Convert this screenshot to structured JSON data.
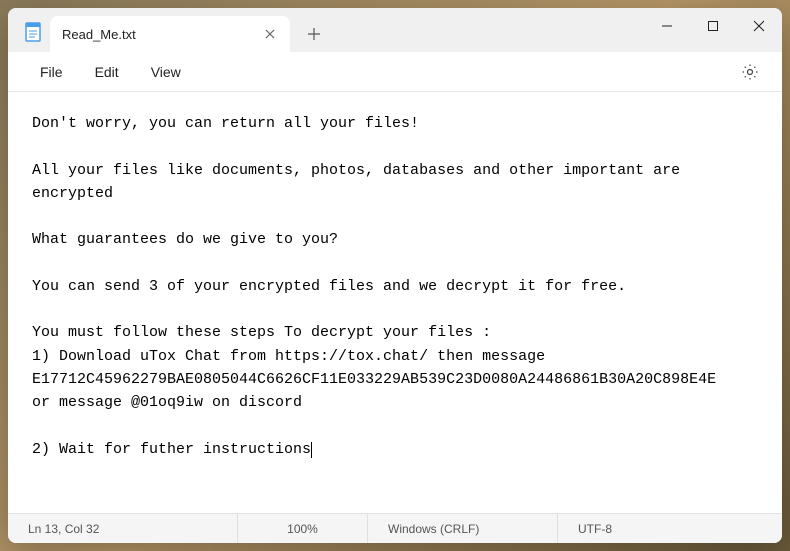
{
  "tab": {
    "title": "Read_Me.txt"
  },
  "menu": {
    "file": "File",
    "edit": "Edit",
    "view": "View"
  },
  "content": {
    "line1": "Don't worry, you can return all your files!",
    "line2": "",
    "line3": "All your files like documents, photos, databases and other important are encrypted",
    "line4": "",
    "line5": "What guarantees do we give to you?",
    "line6": "",
    "line7": "You can send 3 of your encrypted files and we decrypt it for free.",
    "line8": "",
    "line9": "You must follow these steps To decrypt your files :",
    "line10": "1) Download uTox Chat from https://tox.chat/ then message E17712C45962279BAE0805044C6626CF11E033229AB539C23D0080A24486861B30A20C898E4E",
    "line11": "or message @01oq9iw on discord",
    "line12": "",
    "line13": "2) Wait for futher instructions"
  },
  "status": {
    "position": "Ln 13, Col 32",
    "zoom": "100%",
    "line_ending": "Windows (CRLF)",
    "encoding": "UTF-8"
  }
}
